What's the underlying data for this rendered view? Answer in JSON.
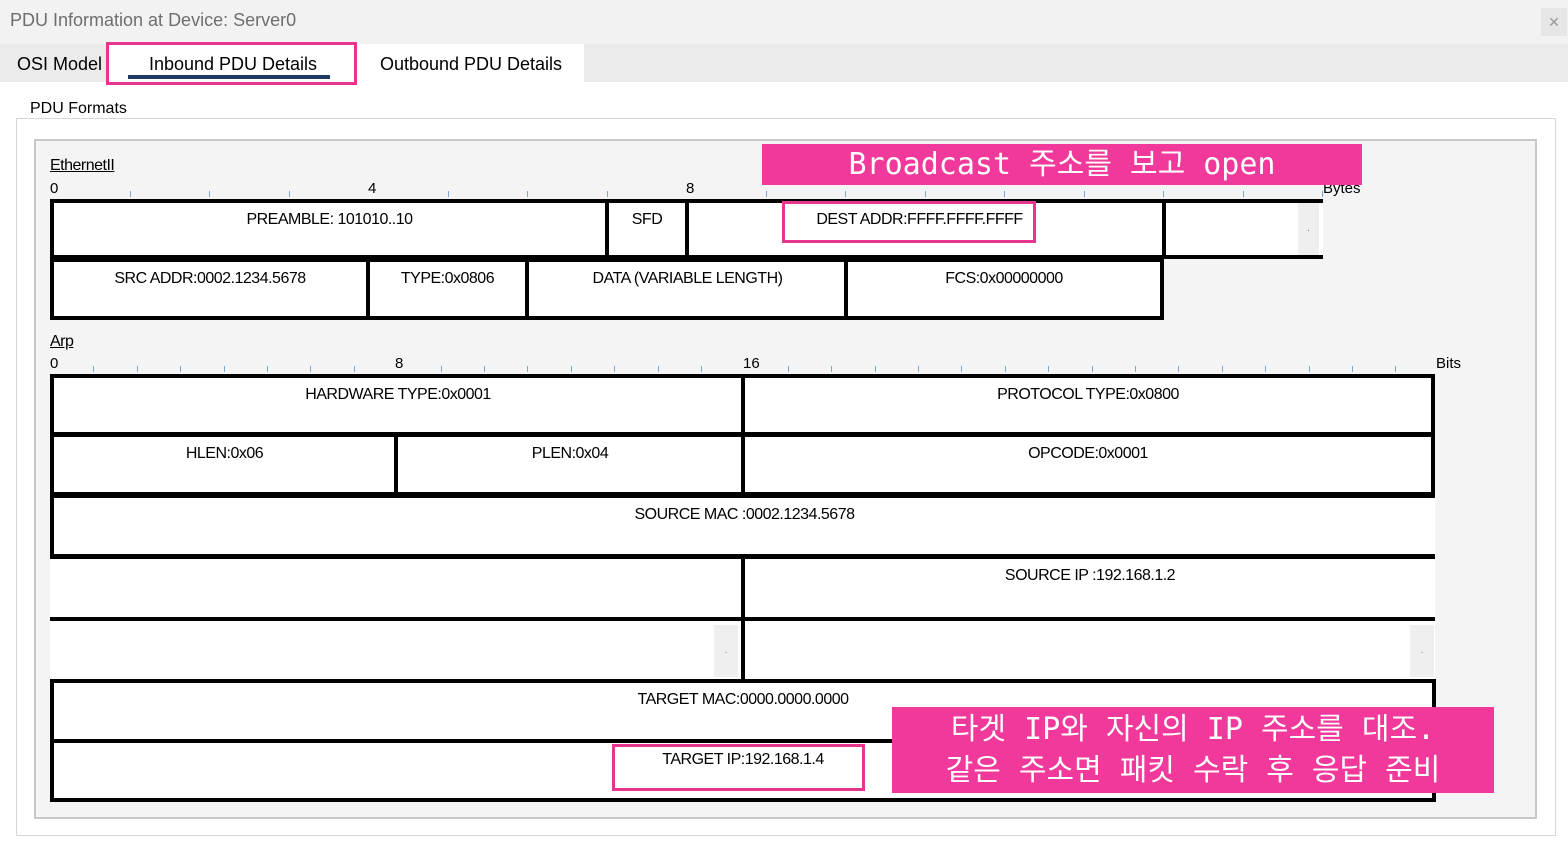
{
  "window": {
    "title": "PDU Information at Device: Server0",
    "close_glyph": "✕"
  },
  "tabs": [
    "OSI Model",
    "Inbound PDU Details",
    "Outbound PDU Details"
  ],
  "group_label": "PDU Formats",
  "ethernet": {
    "label": "EthernetII",
    "scale_labels": [
      "0",
      "4",
      "8"
    ],
    "unit": "Bytes",
    "fields": {
      "preamble": "PREAMBLE: 101010..10",
      "sfd": "SFD",
      "dest": "DEST ADDR:FFFF.FFFF.FFFF",
      "src": "SRC ADDR:0002.1234.5678",
      "type": "TYPE:0x0806",
      "data": "DATA (VARIABLE LENGTH)",
      "fcs": "FCS:0x00000000"
    }
  },
  "arp": {
    "label": "Arp",
    "scale_labels": [
      "0",
      "8",
      "16"
    ],
    "unit": "Bits",
    "fields": {
      "hw_type": "HARDWARE TYPE:0x0001",
      "proto_type": "PROTOCOL TYPE:0x0800",
      "hlen": "HLEN:0x06",
      "plen": "PLEN:0x04",
      "opcode": "OPCODE:0x0001",
      "src_mac": "SOURCE MAC :0002.1234.5678",
      "src_ip": "SOURCE IP :192.168.1.2",
      "target_mac": "TARGET MAC:0000.0000.0000",
      "target_ip": "TARGET IP:192.168.1.4"
    }
  },
  "annotations": {
    "broadcast": "Broadcast 주소를 보고 open",
    "target_line1": "타겟 IP와 자신의 IP 주소를 대조.",
    "target_line2": "같은 주소면 패킷 수락 후 응답 준비",
    "highlight_color": "#e8368f",
    "callout_color": "#f0399a"
  }
}
